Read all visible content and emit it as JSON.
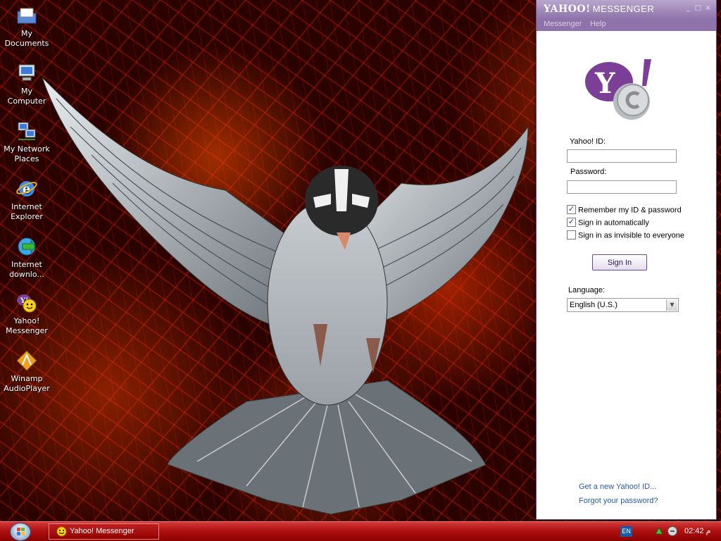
{
  "desktop": {
    "icons": [
      {
        "label": "My Documents",
        "icon": "folder-documents-icon"
      },
      {
        "label": "My Computer",
        "icon": "computer-icon"
      },
      {
        "label": "My Network\nPlaces",
        "icon": "network-places-icon"
      },
      {
        "label": "Internet\nExplorer",
        "icon": "internet-explorer-icon"
      },
      {
        "label": "Internet\ndownlo...",
        "icon": "download-manager-icon"
      },
      {
        "label": "Yahoo!\nMessenger",
        "icon": "yahoo-messenger-icon"
      },
      {
        "label": "Winamp\nAudioPlayer",
        "icon": "winamp-icon"
      }
    ]
  },
  "messenger": {
    "title_brand": "YAHOO!",
    "title_product": "MESSENGER",
    "menu": [
      "Messenger",
      "Help"
    ],
    "yahoo_id_label": "Yahoo! ID:",
    "yahoo_id_value": "",
    "password_label": "Password:",
    "password_value": "",
    "checkboxes": [
      {
        "label": "Remember my ID & password",
        "checked": true
      },
      {
        "label": "Sign in automatically",
        "checked": true
      },
      {
        "label": "Sign in as invisible to everyone",
        "checked": false
      }
    ],
    "signin_label": "Sign In",
    "language_label": "Language:",
    "language_value": "English (U.S.)",
    "links": [
      "Get a new Yahoo! ID...",
      "Forgot your password?"
    ],
    "colors": {
      "accent": "#7b3f98",
      "titlebar": "#8e73ab",
      "link": "#2a5aa8"
    }
  },
  "taskbar": {
    "task_label": "Yahoo! Messenger",
    "language_indicator": "EN",
    "clock": "02:42 م",
    "colors": {
      "bar": "#b01010"
    }
  }
}
